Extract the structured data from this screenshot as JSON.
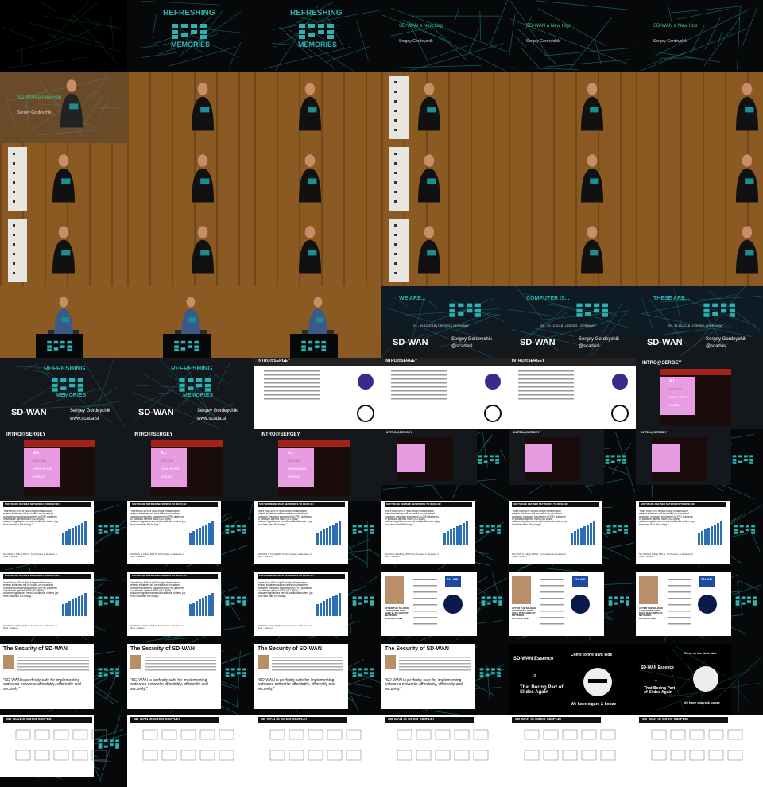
{
  "sheet": {
    "rows": 11,
    "cols": 6
  },
  "colors": {
    "stage_wood": "#8a5a22",
    "stage_wood_dark": "#5a3410",
    "dark_bg": "#06080a",
    "net_line": "#1d6b6b",
    "title_green": "#3fd08a",
    "logo_teal": "#2bb3b3",
    "pink": "#e79be0",
    "red_bar": "#a5221b",
    "white": "#ffffff"
  },
  "texts": {
    "refreshing": "REFRESHING",
    "memories": "MEMORIES",
    "talk_title": "SD-WAN a New Hop",
    "speaker": "Sergey Gordeychik",
    "handle": "@scadasl",
    "site": "www.scada.sl",
    "sdwan_logo": "SD-WAN",
    "new_hop": "A NEW HOP",
    "event_date": "29 - 30.12.2018 | LEIPZIG | GERMANY",
    "we_are": "WE ARE...",
    "computer_is": "COMPUTER IS...",
    "these_are": "THESE ARE...",
    "intro": "INTRO@SERGEY",
    "menu_ai": "A.I.",
    "menu_bitcoin": "BITCOIN",
    "menu_fake_news": "FAKE NEWS",
    "menu_russia": "RUSSIA",
    "sdn_title": "SOFTWARE DEFINED NETWORKS TO RESCUE!",
    "sdn_quote": "\"more than 40% of WAN edge infrastructure refresh initiatives will be based on virtualized customer premises equipment (vCPE) platforms or software-defined WAN (SD-WAN) software/appliances versus traditional routers (up from less than 5% today).\"",
    "sdn_source": "SD-WAN Is Killing MPLS, So Prepare to Replace It Now - Gartner",
    "sec_title": "The Security of SD-WAN",
    "sec_quote": "\"SD-WAN is perfectly safe for implementing widearea networks affordably, efficiently and securely.\"",
    "after_sdwan": "AFTER THE SD-WAN LOCKDOWN HOW SAFE IS TO DEPLOY NETWORK APPLICATIONS",
    "talari": "TALARI",
    "essence": "SD-WAN Essence",
    "or": "or",
    "boring": "That Boring Part of Slides Again",
    "dark_side": "Come to the dark side",
    "cigars": "We have cigars & booze",
    "simple": "SD-WAN IS SOOO SIMPLE!"
  },
  "tiles": [
    "dark-intro",
    "ccc-logo",
    "ccc-logo",
    "title-slide",
    "title-slide",
    "title-slide",
    "title-fade",
    "stage",
    "stage",
    "stage",
    "stage",
    "stage",
    "stage",
    "stage",
    "stage",
    "stage",
    "stage",
    "stage",
    "stage",
    "stage",
    "stage",
    "stage",
    "stage",
    "stage",
    "presenter",
    "presenter",
    "presenter",
    "we-are",
    "computer-is",
    "these-are",
    "ccc-sdwan",
    "ccc-sdwan",
    "bio-slide",
    "bio-slide",
    "bio-slide",
    "intro-menu",
    "intro-menu",
    "intro-menu",
    "intro-menu",
    "intro-menu-pip",
    "intro-menu-pip",
    "intro-menu-pip",
    "sdn",
    "sdn",
    "sdn",
    "sdn",
    "sdn",
    "sdn",
    "sdn",
    "sdn",
    "sdn",
    "article",
    "article",
    "article",
    "security",
    "security",
    "security",
    "security",
    "essence",
    "essence-dark",
    "simple",
    "simple",
    "simple",
    "simple",
    "simple",
    "simple"
  ]
}
